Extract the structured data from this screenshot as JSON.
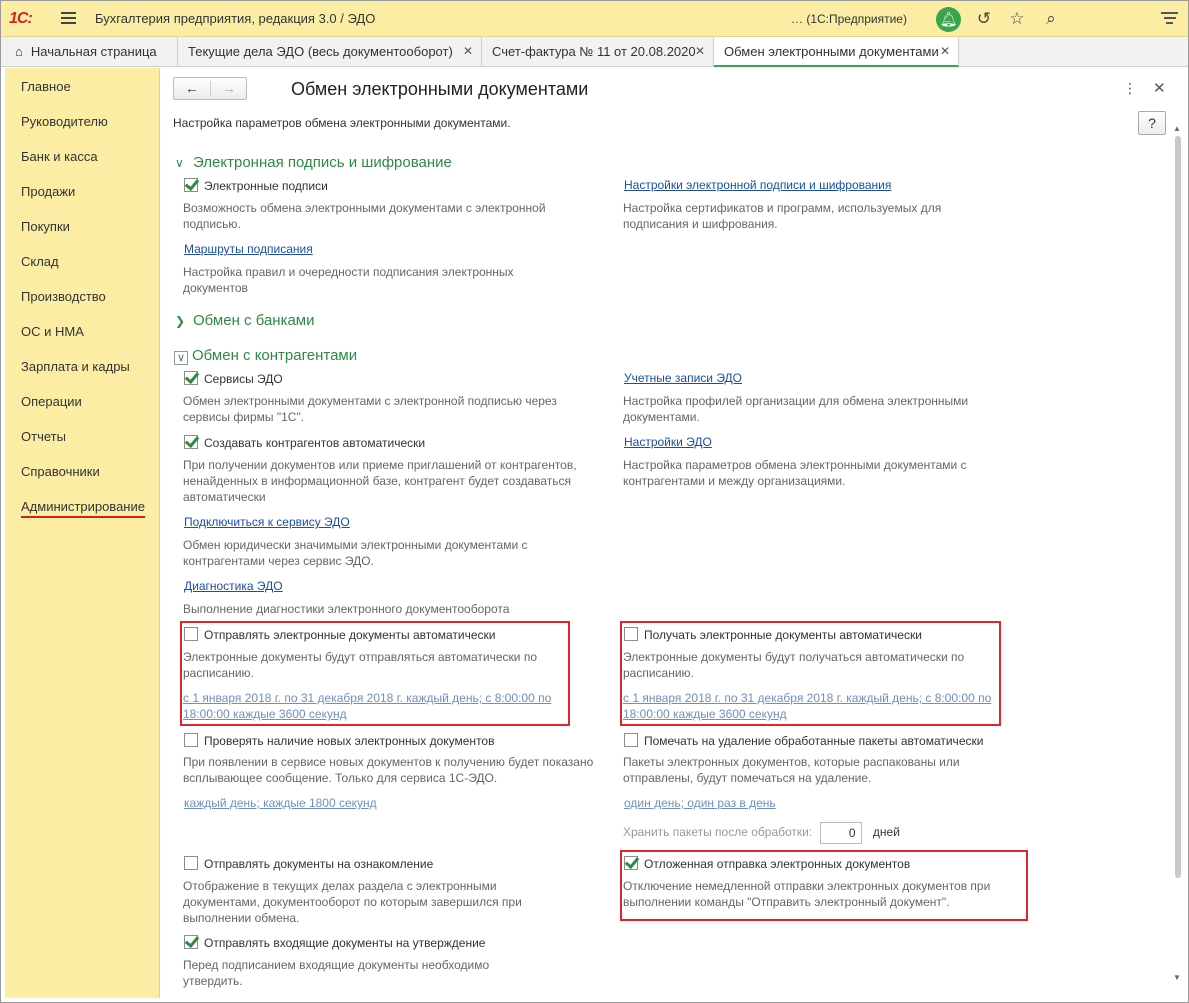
{
  "app": {
    "logo": "1С:",
    "title": "Бухгалтерия предприятия, редакция 3.0 / ЭДО",
    "platform": "…  (1С:Предприятие)"
  },
  "tabs": [
    {
      "label": "Начальная страница"
    },
    {
      "label": "Текущие дела ЭДО (весь документооборот)"
    },
    {
      "label": "Счет-фактура № 11 от 20.08.2020"
    },
    {
      "label": "Обмен электронными документами"
    }
  ],
  "sidebar": {
    "items": [
      {
        "label": "Главное"
      },
      {
        "label": "Руководителю"
      },
      {
        "label": "Банк и касса"
      },
      {
        "label": "Продажи"
      },
      {
        "label": "Покупки"
      },
      {
        "label": "Склад"
      },
      {
        "label": "Производство"
      },
      {
        "label": "ОС и НМА"
      },
      {
        "label": "Зарплата и кадры"
      },
      {
        "label": "Операции"
      },
      {
        "label": "Отчеты"
      },
      {
        "label": "Справочники"
      },
      {
        "label": "Администрирование"
      }
    ]
  },
  "page": {
    "title": "Обмен электронными документами",
    "subtitle": "Настройка параметров обмена электронными документами.",
    "help_label": "?"
  },
  "sections": {
    "signature": {
      "title": "Электронная подпись и шифрование",
      "e_signatures_label": "Электронные подписи",
      "e_signatures_desc": "Возможность обмена электронными документами с электронной подписью.",
      "settings_link": "Настройки электронной подписи и шифрования",
      "settings_desc": "Настройка сертификатов и программ, используемых для подписания и шифрования.",
      "routes_link": "Маршруты подписания",
      "routes_desc": "Настройка правил и очередности подписания электронных документов"
    },
    "banks": {
      "title": "Обмен с банками"
    },
    "counterparties": {
      "title": "Обмен с контрагентами",
      "services_label": "Сервисы ЭДО",
      "services_desc": "Обмен электронными документами с электронной подписью через сервисы фирмы \"1С\".",
      "accounts_link": "Учетные записи ЭДО",
      "accounts_desc": "Настройка профилей организации для обмена электронными документами.",
      "auto_create_label": "Создавать контрагентов автоматически",
      "auto_create_desc": "При получении документов или приеме приглашений от контрагентов, ненайденных в информационной базе, контрагент будет создаваться автоматически",
      "edo_settings_link": "Настройки ЭДО",
      "edo_settings_desc": "Настройка параметров обмена электронными документами с контрагентами и между организациями.",
      "connect_link": "Подключиться к сервису ЭДО",
      "connect_desc": "Обмен юридически значимыми электронными документами с контрагентами через сервис ЭДО.",
      "diag_link": "Диагностика ЭДО",
      "diag_desc": "Выполнение диагностики электронного документооборота",
      "send_auto_label": "Отправлять электронные документы автоматически",
      "send_auto_desc": "Электронные документы будут отправляться автоматически по расписанию.",
      "send_schedule": "с 1 января 2018 г. по 31 декабря 2018 г. каждый день; с 8:00:00 по 18:00:00 каждые 3600 секунд",
      "recv_auto_label": "Получать электронные документы автоматически",
      "recv_auto_desc": "Электронные документы будут получаться автоматически по расписанию.",
      "recv_schedule": "с 1 января 2018 г. по 31 декабря 2018 г. каждый день; с 8:00:00 по 18:00:00 каждые 3600 секунд",
      "check_new_label": "Проверять наличие новых электронных документов",
      "check_new_desc": "При появлении в сервисе новых документов к получению будет показано всплывающее сообщение. Только для сервиса 1С-ЭДО.",
      "check_schedule": "каждый день; каждые 1800 секунд",
      "mark_delete_label": "Помечать на удаление обработанные пакеты автоматически",
      "mark_delete_desc": "Пакеты электронных документов, которые распакованы или отправлены, будут помечаться на удаление.",
      "mark_schedule": "один день; один раз в день",
      "keep_label": "Хранить пакеты после обработки:",
      "keep_value": "0",
      "keep_unit": "дней",
      "review_label": "Отправлять документы на ознакомление",
      "review_desc": "Отображение в текущих делах  раздела с электронными документами, документооборот по которым завершился при выполнении обмена.",
      "deferred_label": "Отложенная отправка электронных документов",
      "deferred_desc": "Отключение немедленной отправки электронных документов при выполнении команды \"Отправить электронный документ\".",
      "approval_label": "Отправлять входящие документы на утверждение",
      "approval_desc": "Перед подписанием входящие документы необходимо утвердить."
    }
  }
}
